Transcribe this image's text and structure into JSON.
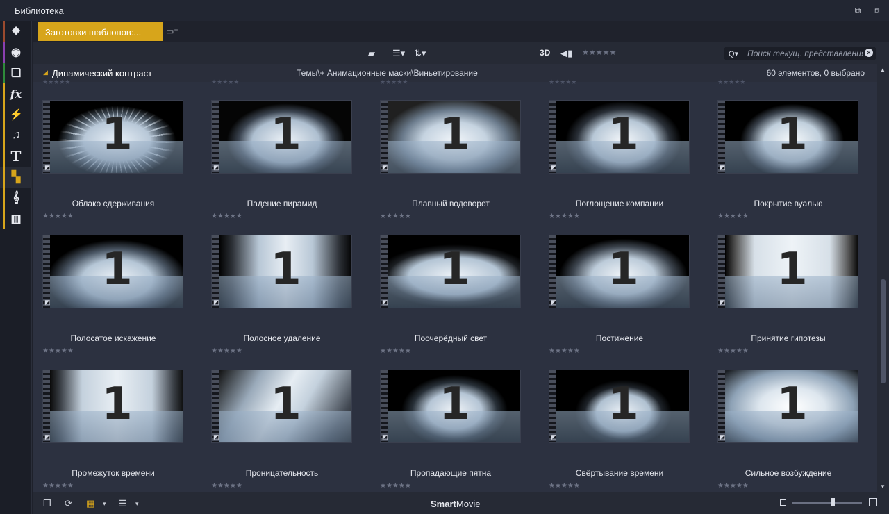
{
  "window": {
    "title": "Библиотека",
    "restore_icon": "restore-window-icon",
    "popout_icon": "popout-icon"
  },
  "rail": [
    {
      "icon": "project-bin-icon",
      "glyph": "❖",
      "strip_color": "#9b4a2e"
    },
    {
      "icon": "film-reel-icon",
      "glyph": "◉",
      "strip_color": "#8a3fb0"
    },
    {
      "icon": "stack-icon",
      "glyph": "❏",
      "strip_color": "#2e8a3a"
    },
    {
      "icon": "fx-icon",
      "glyph": "fx",
      "strip_color": "#d7a51b"
    },
    {
      "icon": "transition-icon",
      "glyph": "⚡",
      "strip_color": "#d7a51b"
    },
    {
      "icon": "music-note-icon",
      "glyph": "♫",
      "strip_color": "#d7a51b"
    },
    {
      "icon": "title-text-icon",
      "glyph": "T",
      "strip_color": "#d7a51b"
    },
    {
      "icon": "templates-icon",
      "glyph": "▚",
      "strip_color": "#d7a51b"
    },
    {
      "icon": "treble-clef-icon",
      "glyph": "𝄞",
      "strip_color": "#d7a51b"
    },
    {
      "icon": "piano-keys-icon",
      "glyph": "▥",
      "strip_color": "#d7a51b"
    }
  ],
  "tabs": {
    "active_label": "Заготовки шаблонов:...",
    "add_icon": "add-tab-icon"
  },
  "toolbar": {
    "folder_icon": "folder-icon",
    "list_icon": "list-view-icon",
    "sort_icon": "sort-icon",
    "three_d_label": "3D",
    "tag_icon": "tag-icon",
    "rating_stars": "★★★★★",
    "search_placeholder": "Поиск текущ. представления"
  },
  "section": {
    "title": "Динамический контраст",
    "path": "Темы\\+ Анимационные маски\\Виньетирование",
    "count": "60 элементов, 0 выбрано"
  },
  "items": [
    {
      "name": "Облако сдерживания",
      "stars": "★★★★★",
      "style": "burst"
    },
    {
      "name": "Падение пирамид",
      "stars": "★★★★★",
      "style": "shards"
    },
    {
      "name": "Плавный водоворот",
      "stars": "★★★★★",
      "style": "swirl"
    },
    {
      "name": "Поглощение компании",
      "stars": "★★★★★",
      "style": "beams"
    },
    {
      "name": "Покрытие вуалью",
      "stars": "★★★★★",
      "style": "veil"
    },
    {
      "name": "Полосатое искажение",
      "stars": "★★★★★",
      "style": "rays"
    },
    {
      "name": "Полосное удаление",
      "stars": "★★★★★",
      "style": "stripes"
    },
    {
      "name": "Поочерёдный свет",
      "stars": "★★★★★",
      "style": "lights"
    },
    {
      "name": "Постижение",
      "stars": "★★★★★",
      "style": "soft"
    },
    {
      "name": "Принятие гипотезы",
      "stars": "★★★★★",
      "style": "curtain"
    },
    {
      "name": "Промежуток времени",
      "stars": "★★★★★",
      "style": "blinds"
    },
    {
      "name": "Проницательность",
      "stars": "★★★★★",
      "style": "diagonal"
    },
    {
      "name": "Пропадающие пятна",
      "stars": "★★★★★",
      "style": "sparkle"
    },
    {
      "name": "Свёртывание времени",
      "stars": "★★★★★",
      "style": "pentagon"
    },
    {
      "name": "Сильное возбуждение",
      "stars": "★★★★★",
      "style": "flash"
    }
  ],
  "thumb_number": "1",
  "bottombar": {
    "brand_bold": "Smart",
    "brand_rest": "Movie",
    "zoom_level": 0.58
  }
}
